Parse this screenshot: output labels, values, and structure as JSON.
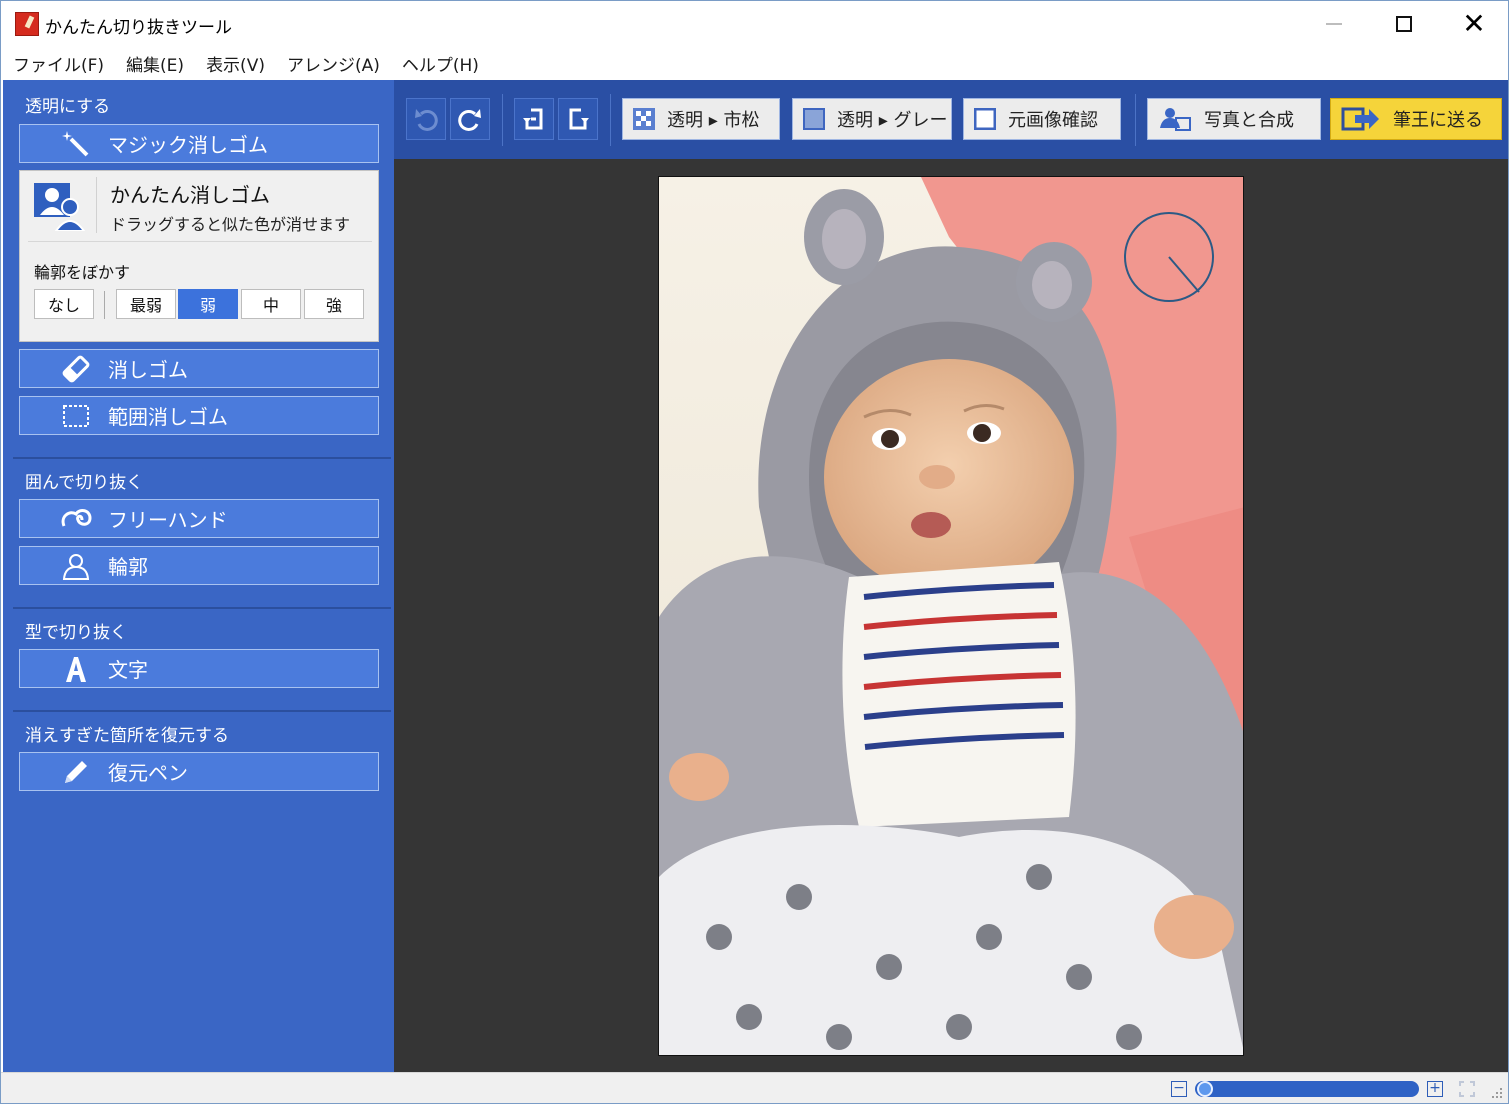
{
  "window": {
    "title": "かんたん切り抜きツール",
    "controls": {
      "minimize": "—",
      "maximize": "",
      "close": "✕"
    }
  },
  "menu": [
    "ファイル(F)",
    "編集(E)",
    "表示(V)",
    "アレンジ(A)",
    "ヘルプ(H)"
  ],
  "sidebar": {
    "section_transparent": "透明にする",
    "magic_eraser": "マジック消しゴム",
    "easy_eraser": {
      "title": "かんたん消しゴム",
      "description": "ドラッグすると似た色が消せます",
      "blur_label": "輪郭をぼかす",
      "blur_options": [
        "なし",
        "最弱",
        "弱",
        "中",
        "強"
      ],
      "blur_selected": "弱"
    },
    "eraser": "消しゴム",
    "range_eraser": "範囲消しゴム",
    "section_enclose": "囲んで切り抜く",
    "freehand": "フリーハンド",
    "outline": "輪郭",
    "section_shape": "型で切り抜く",
    "text": "文字",
    "section_restore": "消えすぎた箇所を復元する",
    "restore_pen": "復元ペン"
  },
  "toolbar": {
    "view_checker": "透明 ▸ 市松",
    "view_gray": "透明 ▸ グレー",
    "view_original": "元画像確認",
    "compose": "写真と合成",
    "send": "筆王に送る"
  },
  "icons": {
    "undo": "undo-icon",
    "redo": "redo-icon",
    "rotate_left": "rotate-left-icon",
    "rotate_right": "rotate-right-icon"
  },
  "colors": {
    "sidebar": "#3a66c5",
    "button": "#4b7bdc",
    "toolbar": "#2a4fa4",
    "canvas": "#353535",
    "send_button": "#f5d43a",
    "selected_option": "#3c72dc"
  }
}
